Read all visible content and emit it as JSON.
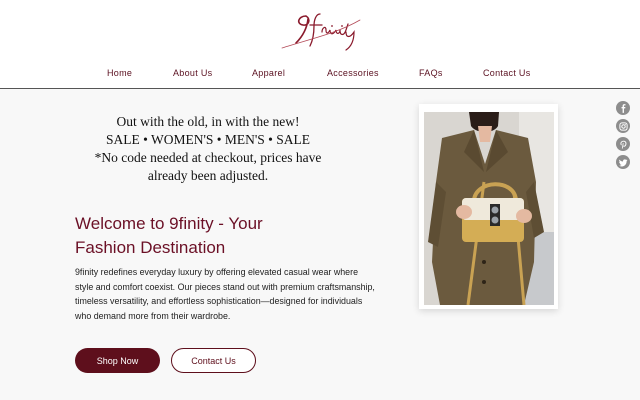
{
  "site": {
    "logo_alt": "9finity"
  },
  "nav": {
    "items": [
      {
        "label": "Home"
      },
      {
        "label": "About Us"
      },
      {
        "label": "Apparel"
      },
      {
        "label": "Accessories"
      },
      {
        "label": "FAQs"
      },
      {
        "label": "Contact Us"
      }
    ]
  },
  "promo": {
    "line1": "Out with the old, in with the new!",
    "line2": "SALE • WOMEN'S • MEN'S • SALE",
    "line3": "*No code needed at checkout, prices have already been adjusted."
  },
  "hero": {
    "title": "Welcome to 9finity - Your Fashion Destination",
    "description": "9finity redefines everyday luxury by offering elevated casual wear where style and comfort coexist. Our pieces stand out with premium craftsmanship, timeless versatility, and effortless sophistication—designed for individuals who demand more from their wardrobe.",
    "shop_button": "Shop Now",
    "contact_button": "Contact Us"
  },
  "social": {
    "icons": [
      "facebook-icon",
      "instagram-icon",
      "pinterest-icon",
      "twitter-icon"
    ]
  },
  "colors": {
    "brand": "#6b1026",
    "button_fill": "#5e0f1c",
    "background": "#f8f8f8",
    "social_icon": "#8d8d8d"
  }
}
